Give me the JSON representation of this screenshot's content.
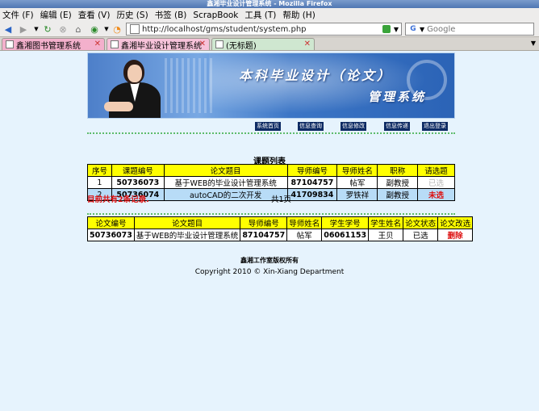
{
  "window": {
    "title": "鑫湘毕业设计管理系统 - Mozilla Firefox"
  },
  "menu": [
    "文件 (F)",
    "编辑 (E)",
    "查看 (V)",
    "历史 (S)",
    "书签 (B)",
    "ScrapBook",
    "工具 (T)",
    "帮助 (H)"
  ],
  "toolbar": {
    "url": "http://localhost/gms/student/system.php",
    "search_placeholder": "Google",
    "search_engine": "G"
  },
  "tabs": [
    {
      "label": "鑫湘图书管理系统"
    },
    {
      "label": "鑫湘毕业设计管理系统"
    },
    {
      "label": "(无标题)"
    }
  ],
  "banner": {
    "title_line1": "本科毕业设计（论文）",
    "title_line2": "管理系统"
  },
  "nav_links": [
    "系统首页",
    "信息查询",
    "信息修改",
    "信息传递",
    "退出登录"
  ],
  "topic_list": {
    "title": "课题列表",
    "headers": [
      "序号",
      "课题编号",
      "论文题目",
      "导师编号",
      "导师姓名",
      "职称",
      "请选题"
    ],
    "rows": [
      {
        "no": "1",
        "code": "50736073",
        "title": "基于WEB的毕业设计管理系统",
        "tutor_id": "87104757",
        "tutor_name": "帖军",
        "rank": "副教授",
        "action": "已选"
      },
      {
        "no": "2",
        "code": "50736074",
        "title": "autoCAD的二次开发",
        "tutor_id": "41709834",
        "tutor_name": "罗铁祥",
        "rank": "副教授",
        "action": "未选"
      }
    ],
    "record_text": "目前共有2条记录.",
    "page_text": "共1页"
  },
  "my_selection": {
    "headers": [
      "论文编号",
      "论文题目",
      "导师编号",
      "导师姓名",
      "学生学号",
      "学生姓名",
      "论文状态",
      "论文改选"
    ],
    "row": {
      "code": "50736073",
      "title": "基于WEB的毕业设计管理系统",
      "tutor_id": "87104757",
      "tutor_name": "帖军",
      "student_id": "06061153",
      "student_name": "王贝",
      "status": "已选",
      "action": "删除"
    }
  },
  "footer": {
    "line1": "鑫湘工作室版权所有",
    "line2": "Copyright 2010 © Xin-Xiang Department"
  },
  "colors": {
    "header_yellow": "#ffff00",
    "row_blue": "#b8dcf7",
    "accent_red": "#dd1111",
    "page_bg": "#e6f3fd",
    "nav_button": "#0d2a63"
  }
}
